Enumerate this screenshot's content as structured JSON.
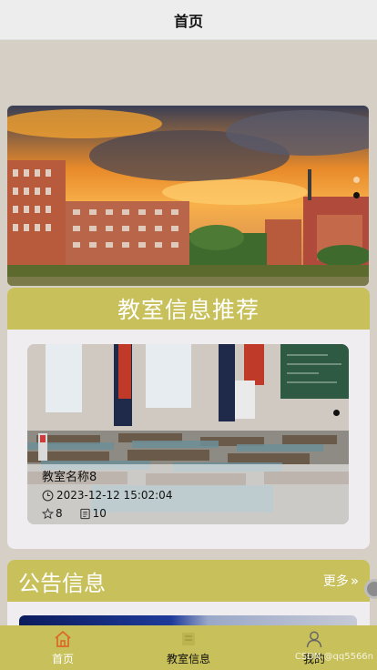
{
  "header": {
    "title": "首页"
  },
  "banner": {
    "slides": 2,
    "active_index": 1
  },
  "recommend": {
    "title": "教室信息推荐",
    "card": {
      "name": "教室名称8",
      "time": "2023-12-12 15:02:04",
      "favorites": "8",
      "views": "10"
    }
  },
  "notice": {
    "title": "公告信息",
    "more": "更多",
    "more_arrow": "»"
  },
  "tabbar": {
    "items": [
      {
        "label": "首页",
        "icon": "home-icon",
        "active": true
      },
      {
        "label": "教室信息",
        "icon": "classroom-icon",
        "active": false
      },
      {
        "label": "我的",
        "icon": "user-icon",
        "active": false
      }
    ]
  },
  "watermark": "CSDN @qq5566n",
  "colors": {
    "accent": "#c8c05a",
    "page_bg": "#d6cfc6",
    "header_bg": "#ededed",
    "card_bg": "#efedf0",
    "home_icon": "#d96b2a"
  }
}
